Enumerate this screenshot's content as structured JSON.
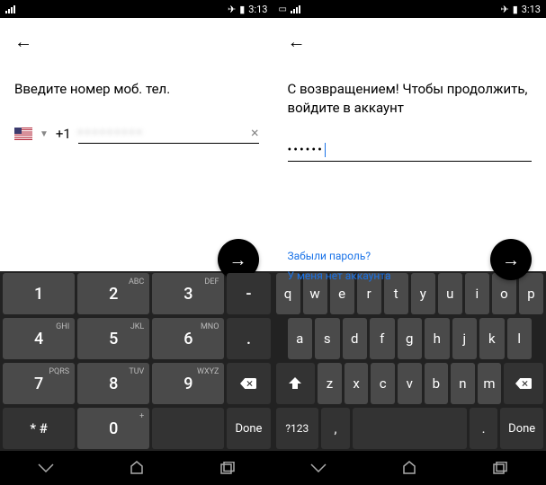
{
  "status": {
    "time": "3:13",
    "airplane": "✈",
    "battery": "▮"
  },
  "left": {
    "heading": "Введите номер моб. тел.",
    "countryCode": "+1",
    "blurred": "• • • • • • • • •",
    "clear": "×"
  },
  "right": {
    "heading": "С возвращением! Чтобы продолжить, войдите в аккаунт",
    "password": "••••••",
    "forgot": "Забыли пароль?",
    "noAccount": "У меня нет аккаунта"
  },
  "numKb": {
    "r1": [
      {
        "n": "1"
      },
      {
        "n": "2",
        "a": "ABC"
      },
      {
        "n": "3",
        "a": "DEF"
      },
      {
        "n": "-"
      }
    ],
    "r2": [
      {
        "n": "4",
        "a": "GHI"
      },
      {
        "n": "5",
        "a": "JKL"
      },
      {
        "n": "6",
        "a": "MNO"
      },
      {
        "n": "."
      }
    ],
    "r3": [
      {
        "n": "7",
        "a": "PQRS"
      },
      {
        "n": "8",
        "a": "TUV"
      },
      {
        "n": "9",
        "a": "WXYZ"
      }
    ],
    "r4": [
      {
        "n": "* #"
      },
      {
        "n": "0",
        "a": "+"
      },
      {
        "n": "Done"
      }
    ]
  },
  "qKb": {
    "r1": [
      "q",
      "w",
      "e",
      "r",
      "t",
      "y",
      "u",
      "i",
      "o",
      "p"
    ],
    "r2": [
      "a",
      "s",
      "d",
      "f",
      "g",
      "h",
      "j",
      "k",
      "l"
    ],
    "r3": [
      "z",
      "x",
      "c",
      "v",
      "b",
      "n",
      "m"
    ],
    "sym": "?123",
    "comma": ",",
    "dot": ".",
    "done": "Done"
  },
  "arrow": "→",
  "back": "←"
}
